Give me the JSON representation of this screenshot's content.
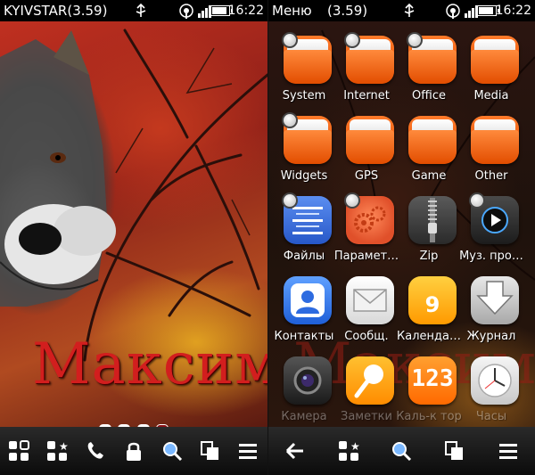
{
  "left_screen": {
    "status": {
      "carrier": "KYIVSTAR(3.59)",
      "time": "16:22"
    },
    "wallpaper_text": "Максим",
    "page_dots": {
      "count": 4,
      "active_index": 3
    },
    "toolbar": [
      "apps-grid-icon",
      "favorites-icon",
      "phone-icon",
      "lock-icon",
      "search-icon",
      "multitask-icon",
      "menu-icon"
    ]
  },
  "right_screen": {
    "status": {
      "title": "Меню",
      "version": "(3.59)",
      "time": "16:22"
    },
    "apps": [
      {
        "label": "System",
        "icon": "folder-icon"
      },
      {
        "label": "Internet",
        "icon": "folder-icon"
      },
      {
        "label": "Office",
        "icon": "folder-icon"
      },
      {
        "label": "Media",
        "icon": "folder-icon"
      },
      {
        "label": "Widgets",
        "icon": "folder-icon"
      },
      {
        "label": "GPS",
        "icon": "folder-icon"
      },
      {
        "label": "Game",
        "icon": "folder-icon"
      },
      {
        "label": "Other",
        "icon": "folder-icon"
      },
      {
        "label": "Файлы",
        "icon": "files-icon"
      },
      {
        "label": "Парамет…",
        "icon": "settings-icon"
      },
      {
        "label": "Zip",
        "icon": "zip-icon"
      },
      {
        "label": "Муз. про…",
        "icon": "music-player-icon"
      },
      {
        "label": "Контакты",
        "icon": "contacts-icon"
      },
      {
        "label": "Сообщ.",
        "icon": "messages-icon"
      },
      {
        "label": "Календа…",
        "icon": "calendar-icon",
        "badge_text": "9"
      },
      {
        "label": "Журнал",
        "icon": "log-icon"
      },
      {
        "label": "Камера",
        "icon": "camera-icon"
      },
      {
        "label": "Заметки",
        "icon": "notes-icon"
      },
      {
        "label": "Каль-к тор",
        "icon": "calculator-icon",
        "badge_text": "123"
      },
      {
        "label": "Часы",
        "icon": "clock-icon"
      }
    ],
    "toolbar": [
      "back-icon",
      "favorites-icon",
      "search-icon",
      "multitask-icon",
      "menu-icon"
    ]
  },
  "colors": {
    "accent_orange": "#ff6a1a",
    "wallpaper_text": "#d21e1e",
    "toolbar_bg": "#1a1a1a"
  }
}
